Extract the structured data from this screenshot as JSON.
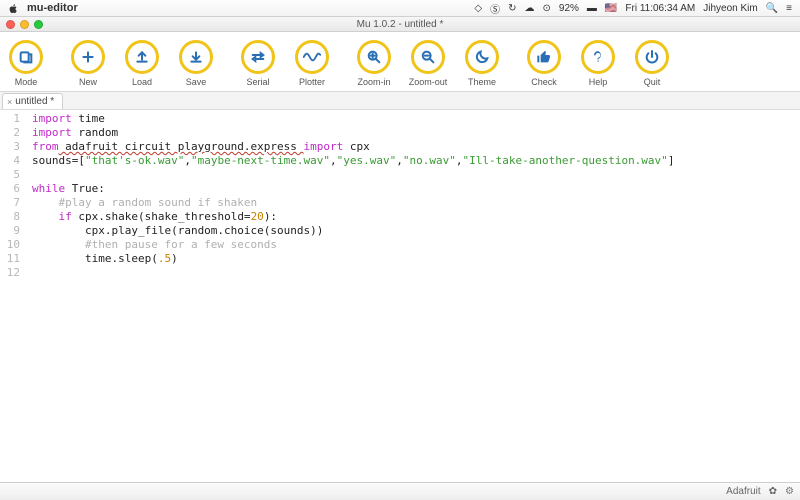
{
  "menubar": {
    "app_name": "mu-editor",
    "battery_pct": "92%",
    "clock": "Fri 11:06:34 AM",
    "user": "Jihyeon Kim"
  },
  "window": {
    "title": "Mu 1.0.2 - untitled *"
  },
  "toolbar": {
    "mode": "Mode",
    "new": "New",
    "load": "Load",
    "save": "Save",
    "serial": "Serial",
    "plotter": "Plotter",
    "zoom_in": "Zoom-in",
    "zoom_out": "Zoom-out",
    "theme": "Theme",
    "check": "Check",
    "help": "Help",
    "quit": "Quit"
  },
  "tab": {
    "close": "×",
    "name": "untitled *"
  },
  "code": {
    "lines": [
      "1",
      "2",
      "3",
      "4",
      "5",
      "6",
      "7",
      "8",
      "9",
      "10",
      "11",
      "12"
    ],
    "l1_a": "import",
    "l1_b": " time",
    "l2_a": "import",
    "l2_b": " random",
    "l3_a": "from",
    "l3_b": " adafruit circuit playground.express ",
    "l3_c": "import",
    "l3_d": " cpx",
    "l4_a": "sounds=[",
    "l4_s1": "\"that's-ok.wav\"",
    "l4_c": ",",
    "l4_s2": "\"maybe-next-time.wav\"",
    "l4_s3": "\"yes.wav\"",
    "l4_s4": "\"no.wav\"",
    "l4_s5": "\"Ill-take-another-question.wav\"",
    "l4_z": "]",
    "l6_a": "while",
    "l6_b": " True:",
    "l7": "    #play a random sound if shaken",
    "l8_a": "    ",
    "l8_b": "if",
    "l8_c": " cpx.shake(shake_threshold=",
    "l8_d": "20",
    "l8_e": "):",
    "l9": "        cpx.play_file(random.choice(sounds))",
    "l10": "        #then pause for a few seconds",
    "l11_a": "        time.sleep(",
    "l11_b": ".5",
    "l11_c": ")"
  },
  "status": {
    "brand": "Adafruit"
  }
}
